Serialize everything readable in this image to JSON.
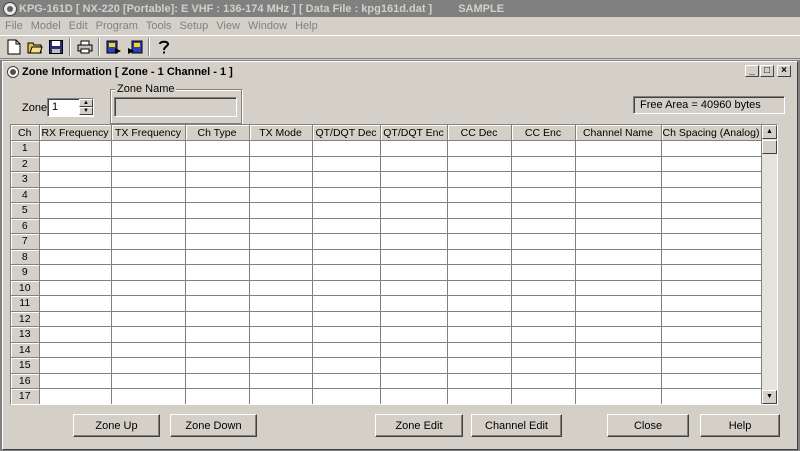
{
  "app": {
    "title": "KPG-161D  [ NX-220  [Portable]: E VHF : 136-174 MHz ] [ Data File : kpg161d.dat ]",
    "sample_label": "SAMPLE"
  },
  "menu": [
    "File",
    "Model",
    "Edit",
    "Program",
    "Tools",
    "Setup",
    "View",
    "Window",
    "Help"
  ],
  "toolbar": [
    "new-file-icon",
    "open-folder-icon",
    "save-disk-icon",
    "print-icon",
    "read-radio-icon",
    "write-radio-icon",
    "help-question-icon"
  ],
  "window": {
    "title": "Zone Information [ Zone - 1  Channel - 1 ]",
    "controls": {
      "minimize": "_",
      "maximize": "□",
      "close": "×"
    }
  },
  "zone": {
    "label": "Zone",
    "value": "1"
  },
  "zone_name": {
    "group_label": "Zone Name",
    "value": ""
  },
  "free_area": "Free Area = 40960 bytes",
  "table": {
    "headers": [
      "Ch",
      "RX Frequency",
      "TX Frequency",
      "Ch Type",
      "TX Mode",
      "QT/DQT Dec",
      "QT/DQT Enc",
      "CC Dec",
      "CC Enc",
      "Channel Name",
      "Ch Spacing (Analog)"
    ],
    "rows": [
      "1",
      "2",
      "3",
      "4",
      "5",
      "6",
      "7",
      "8",
      "9",
      "10",
      "11",
      "12",
      "13",
      "14",
      "15",
      "16",
      "17"
    ]
  },
  "buttons": {
    "zone_up": "Zone Up",
    "zone_down": "Zone Down",
    "zone_edit": "Zone Edit",
    "channel_edit": "Channel Edit",
    "close": "Close",
    "help": "Help"
  }
}
